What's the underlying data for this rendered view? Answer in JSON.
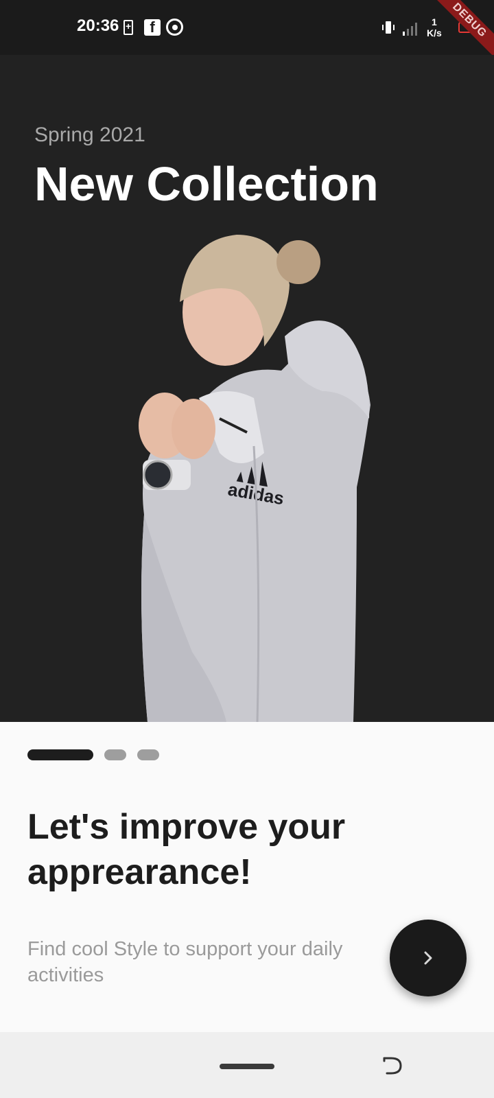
{
  "status_bar": {
    "time": "20:36",
    "net_speed_value": "1",
    "net_speed_unit": "K/s",
    "icons": [
      "battery-charge-icon",
      "facebook-icon",
      "chrome-icon",
      "vibrate-icon",
      "signal-icon",
      "battery-icon"
    ]
  },
  "debug_banner": "DEBUG",
  "hero": {
    "season": "Spring 2021",
    "title": "New Collection",
    "image_brand_text": "adidas"
  },
  "onboarding": {
    "page_count": 3,
    "active_page": 0,
    "headline_line1": "Let's improve your",
    "headline_line2": "apprearance!",
    "subtext": "Find cool Style to support your daily activities",
    "next_icon": "chevron-right-icon"
  },
  "colors": {
    "hero_background": "#222222",
    "sheet_background": "#fafafa",
    "accent_dark": "#1a1a1a",
    "muted_text": "#9a9a9a"
  }
}
